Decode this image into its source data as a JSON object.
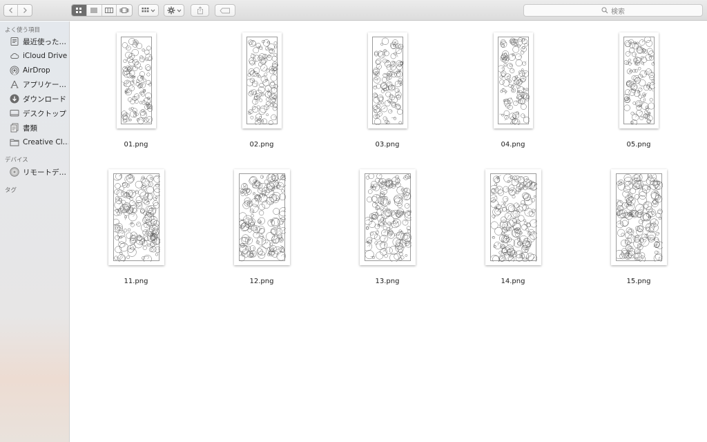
{
  "toolbar": {
    "search_placeholder": "検索",
    "icons": [
      "back-icon",
      "forward-icon",
      "icon-view-icon",
      "list-view-icon",
      "column-view-icon",
      "coverflow-icon",
      "arrange-icon",
      "action-gear-icon",
      "share-icon",
      "tag-icon",
      "search-icon"
    ]
  },
  "sidebar": {
    "favorites_header": "よく使う項目",
    "favorites": [
      {
        "label": "最近使った…",
        "icon": "recents-icon"
      },
      {
        "label": "iCloud Drive",
        "icon": "cloud-icon"
      },
      {
        "label": "AirDrop",
        "icon": "airdrop-icon"
      },
      {
        "label": "アプリケー…",
        "icon": "applications-icon"
      },
      {
        "label": "ダウンロード",
        "icon": "download-icon"
      },
      {
        "label": "デスクトップ",
        "icon": "desktop-icon"
      },
      {
        "label": "書類",
        "icon": "documents-icon"
      },
      {
        "label": "Creative Cl…",
        "icon": "folder-icon"
      }
    ],
    "devices_header": "デバイス",
    "devices": [
      {
        "label": "リモートデ…",
        "icon": "remote-disc-icon"
      }
    ],
    "tags_header": "タグ"
  },
  "files": [
    {
      "name": "01.png",
      "shape": "tall"
    },
    {
      "name": "02.png",
      "shape": "tall"
    },
    {
      "name": "03.png",
      "shape": "tall"
    },
    {
      "name": "04.png",
      "shape": "tall"
    },
    {
      "name": "05.png",
      "shape": "tall"
    },
    {
      "name": "11.png",
      "shape": "wide"
    },
    {
      "name": "12.png",
      "shape": "wide"
    },
    {
      "name": "13.png",
      "shape": "wide"
    },
    {
      "name": "14.png",
      "shape": "wide"
    },
    {
      "name": "15.png",
      "shape": "wide"
    }
  ]
}
